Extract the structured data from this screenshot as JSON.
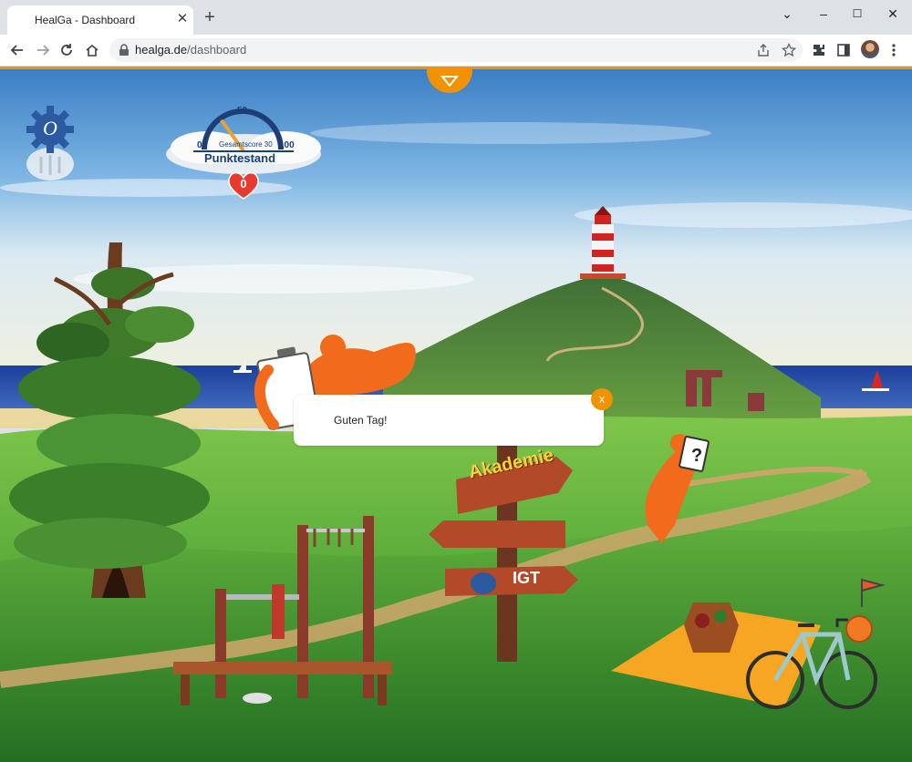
{
  "browser": {
    "tab_title": "HealGa - Dashboard",
    "tab_close": "✕",
    "new_tab": "+",
    "url_host": "healga.de",
    "url_path": "/dashboard",
    "window_controls": {
      "minimize": "–",
      "maximize": "☐",
      "close": "✕",
      "tab_search": "⌄"
    }
  },
  "score_widget": {
    "title": "Punktestand",
    "subtitle": "Gesamtscore 30",
    "min": "0",
    "mid": "50",
    "max": "100",
    "score_value": 30,
    "hearts": "0"
  },
  "settings": {
    "label": "O"
  },
  "dialog": {
    "message": "Guten Tag!",
    "close": "x"
  },
  "signpost": {
    "academy": "Akademie",
    "igt": "IGT"
  },
  "colors": {
    "accent": "#f39200",
    "heart": "#e83a2e",
    "gauge": "#1d3f74"
  }
}
